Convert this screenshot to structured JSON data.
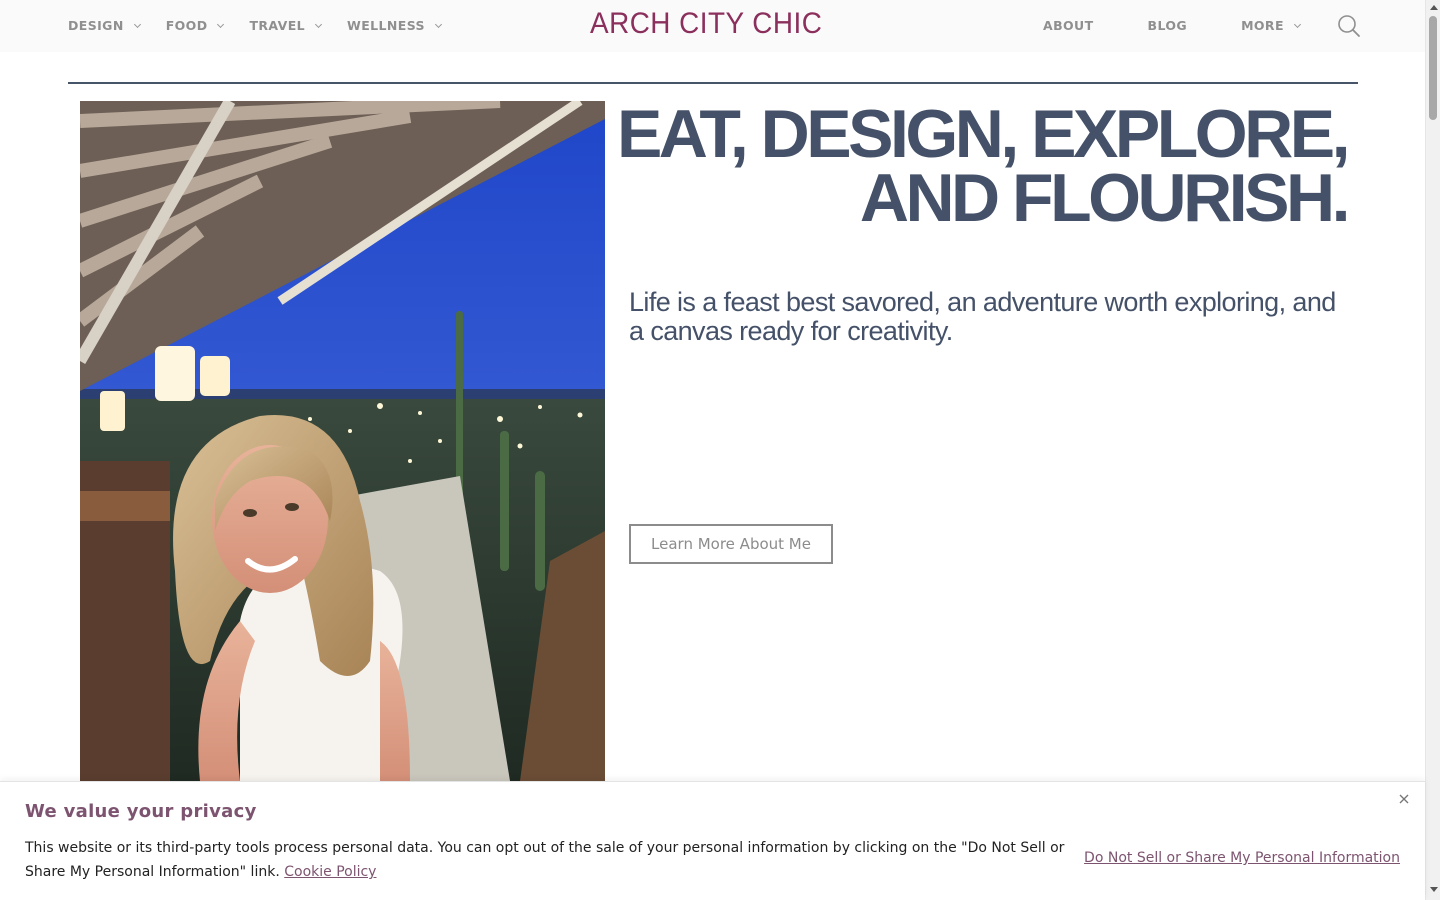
{
  "header": {
    "logo": "ARCH CITY CHIC",
    "nav_left": [
      {
        "label": "DESIGN"
      },
      {
        "label": "FOOD"
      },
      {
        "label": "TRAVEL"
      },
      {
        "label": "WELLNESS"
      }
    ],
    "nav_right": [
      {
        "label": "ABOUT"
      },
      {
        "label": "BLOG"
      },
      {
        "label": "MORE"
      }
    ],
    "search_icon": "search-icon"
  },
  "hero": {
    "headline_line1": "EAT, DESIGN, EXPLORE,",
    "headline_line2": "AND FLOURISH.",
    "tagline": "Life is a feast best savored, an adventure worth exploring, and a canvas ready for creativity.",
    "cta_label": "Learn More About Me"
  },
  "cookie_banner": {
    "title": "We value your privacy",
    "text": "This website or its third-party tools process personal data. You can opt out of the sale of your personal information by clicking on the \"Do Not Sell or Share My Personal Information\" link.",
    "policy_link": "Cookie Policy",
    "opt_out_link": "Do Not Sell or Share My Personal Information",
    "close_icon": "close-icon"
  },
  "colors": {
    "brand": "#8b2f5c",
    "heading": "#445168",
    "nav_text": "#8f8f8f",
    "cookie_accent": "#7d5470"
  }
}
